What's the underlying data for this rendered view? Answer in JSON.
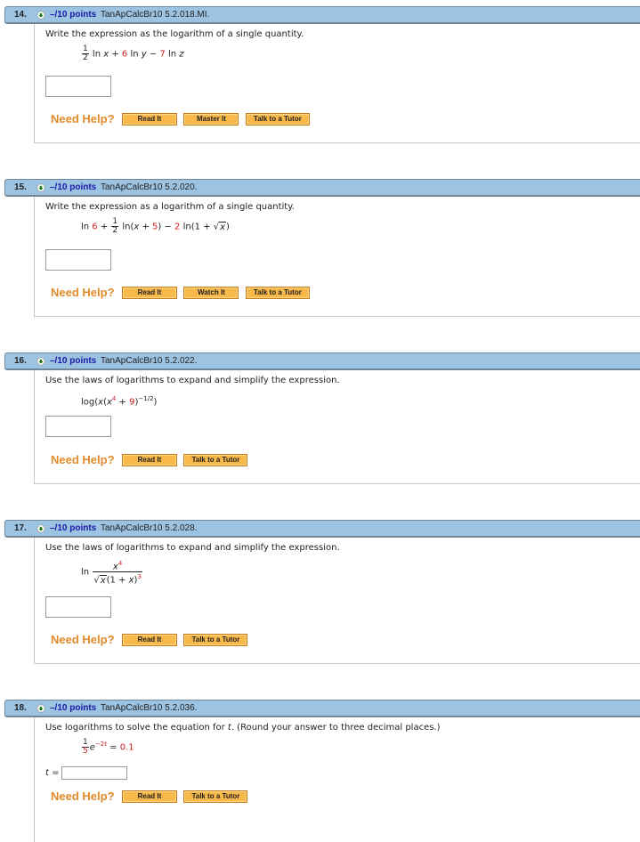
{
  "need_help_label": "Need Help?",
  "questions": [
    {
      "number": "14.",
      "points": "–/10 points",
      "id": "TanApCalcBr10 5.2.018.MI.",
      "prompt": "Write the expression as the logarithm of a single quantity.",
      "expression": {
        "frac_num": "1",
        "frac_den": "2",
        "t1": " ln ",
        "v1": "x",
        "t2": " + ",
        "c1": "6",
        "t3": " ln ",
        "v2": "y",
        "t4": " − ",
        "c2": "7",
        "t5": " ln ",
        "v3": "z"
      },
      "answer_value": "",
      "help_buttons": [
        "Read It",
        "Master It",
        "Talk to a Tutor"
      ]
    },
    {
      "number": "15.",
      "points": "–/10 points",
      "id": "TanApCalcBr10 5.2.020.",
      "prompt": "Write the expression as a logarithm of a single quantity.",
      "expression": {
        "t1": "ln ",
        "c1": "6",
        "t2": " + ",
        "frac_num": "1",
        "frac_den": "2",
        "t3": " ln(",
        "v1": "x",
        "t4": " + ",
        "c2": "5",
        "t5": ") − ",
        "c3": "2",
        "t6": " ln(1 + ",
        "sqrt_sym": "√",
        "v2": "x",
        "t7": ")"
      },
      "answer_value": "",
      "help_buttons": [
        "Read It",
        "Watch It",
        "Talk to a Tutor"
      ]
    },
    {
      "number": "16.",
      "points": "–/10 points",
      "id": "TanApCalcBr10 5.2.022.",
      "prompt": "Use the laws of logarithms to expand and simplify the expression.",
      "expression": {
        "t1": "log(",
        "v1": "x",
        "t2": "(",
        "v2": "x",
        "e1": "4",
        "t3": " + ",
        "c1": "9",
        "t4": ")",
        "e2": "−1/2",
        "t5": ")"
      },
      "answer_value": "",
      "help_buttons": [
        "Read It",
        "Talk to a Tutor"
      ]
    },
    {
      "number": "17.",
      "points": "–/10 points",
      "id": "TanApCalcBr10 5.2.028.",
      "prompt": "Use the laws of logarithms to expand and simplify the expression.",
      "expression": {
        "t1": "ln",
        "num_v": "x",
        "num_e": "4",
        "sqrt_sym": "√",
        "den_v": "x",
        "den_t": "(1 + ",
        "den_v2": "x",
        "den_t2": ")",
        "den_e": "3"
      },
      "answer_value": "",
      "help_buttons": [
        "Read It",
        "Talk to a Tutor"
      ]
    },
    {
      "number": "18.",
      "points": "–/10 points",
      "id": "TanApCalcBr10 5.2.036.",
      "prompt_pre": "Use logarithms to solve the equation for ",
      "prompt_var": "t",
      "prompt_post": ". (Round your answer to three decimal places.)",
      "expression": {
        "frac_num": "1",
        "frac_den": "5",
        "base": "e",
        "exp": "−2t",
        "t1": " = ",
        "c1": "0.1"
      },
      "answer_label": "t =",
      "answer_value": "",
      "help_buttons": [
        "Read It",
        "Talk to a Tutor"
      ]
    }
  ]
}
